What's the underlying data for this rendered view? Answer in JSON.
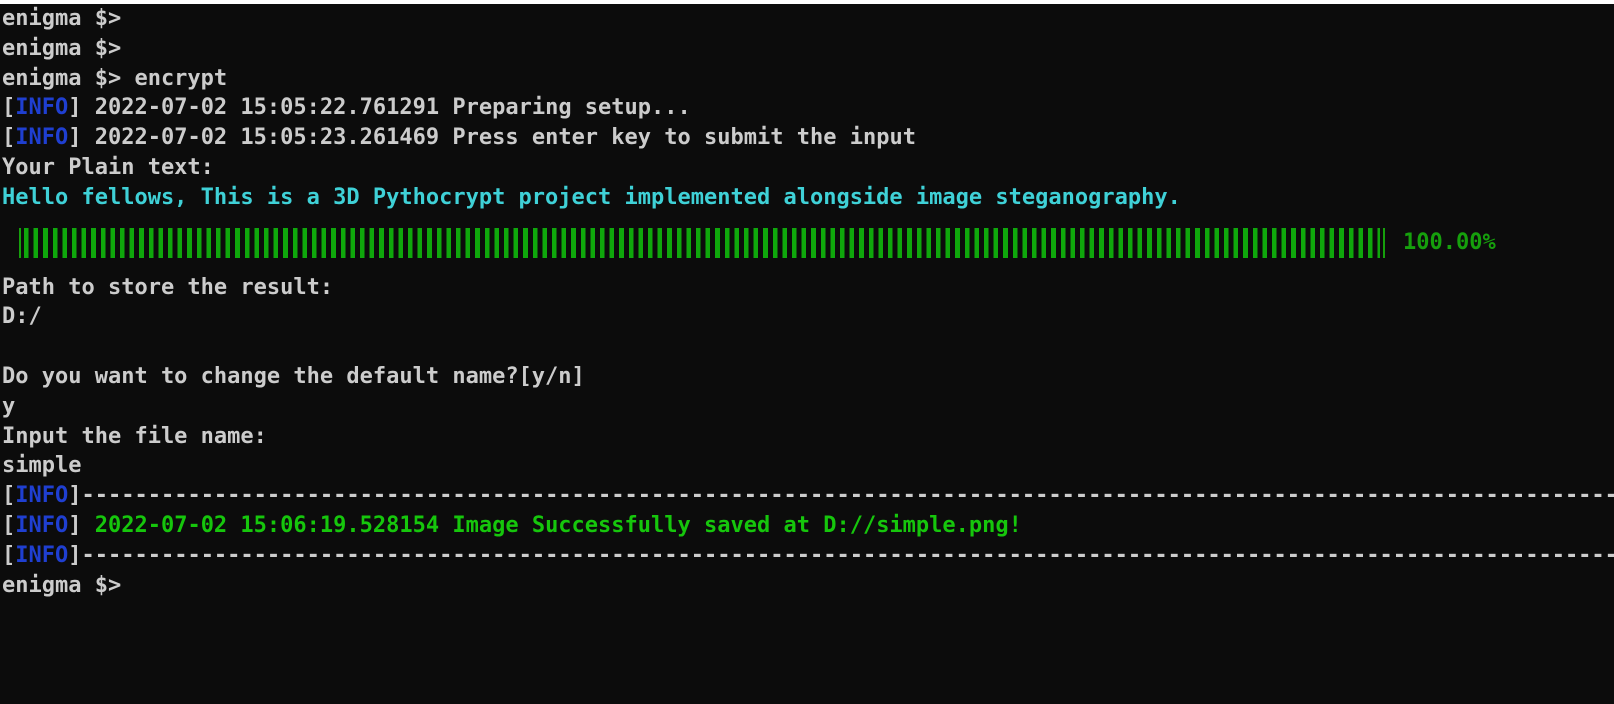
{
  "prompt": "enigma $>",
  "lines": {
    "l1": "enigma $>",
    "l2": "enigma $>",
    "l3": "enigma $> encrypt",
    "l4_ts": " 2022-07-02 15:05:22.761291 ",
    "l4_msg": "Preparing setup...",
    "l5_ts": " 2022-07-02 15:05:23.261469 ",
    "l5_msg": "Press enter key to submit the input",
    "l6": "Your Plain text:",
    "l7": "Hello fellows, This is a 3D Pythocrypt project implemented alongside image steganography.",
    "l9": "Path to store the result:",
    "l10": "D:/",
    "l12": "Do you want to change the default name?[y/n]",
    "l13": "y",
    "l14": "Input the file name:",
    "l15": "simple",
    "l16_dashes": "---------------------------------------------------------------------------------------------------------------------",
    "l17_msg": " 2022-07-02 15:06:19.528154 Image Successfully saved at D://simple.png!",
    "l18_dashes": "---------------------------------------------------------------------------------------------------------------------",
    "l19": "enigma $>"
  },
  "info_label": "INFO",
  "bracket_open": "[",
  "bracket_close": "]",
  "progress": {
    "value_pct": 100.0,
    "label": "100.00%"
  },
  "colors": {
    "background": "#0c0c0c",
    "text": "#cccccc",
    "info": "#1f3fd1",
    "cyan": "#3fd1d7",
    "green": "#16c60c"
  }
}
